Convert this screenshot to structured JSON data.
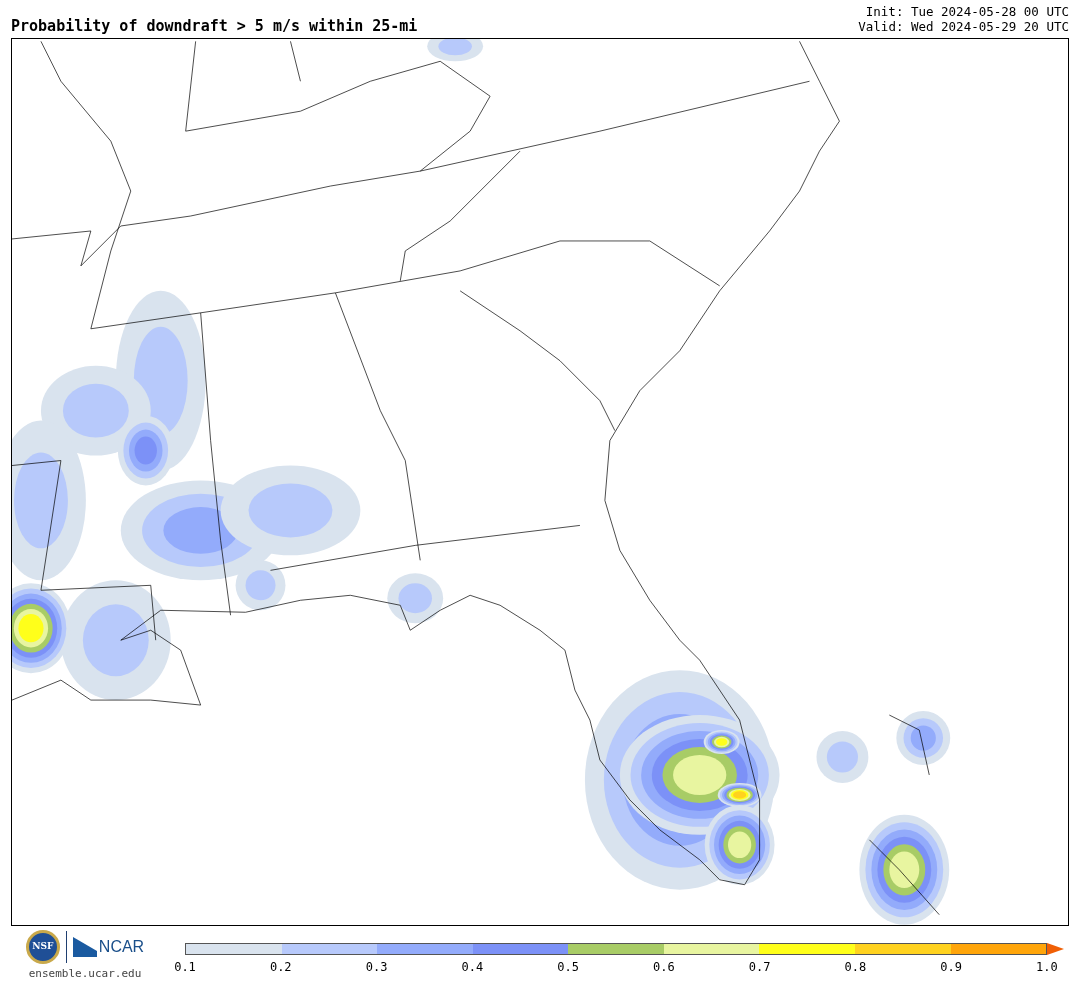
{
  "title": "Probability of downdraft > 5 m/s within 25-mi",
  "init": "Init: Tue 2024-05-28 00 UTC",
  "valid": "Valid: Wed 2024-05-29 20 UTC",
  "logos": {
    "nsf": "NSF",
    "ncar": "NCAR",
    "url": "ensemble.ucar.edu"
  },
  "colorbar": {
    "bins": [
      {
        "color": "#d9e3ee"
      },
      {
        "color": "#b7c9fb"
      },
      {
        "color": "#93abfb"
      },
      {
        "color": "#7c91f7"
      },
      {
        "color": "#a8cc66"
      },
      {
        "color": "#e8f5a0"
      },
      {
        "color": "#ffff1a"
      },
      {
        "color": "#ffd21f"
      },
      {
        "color": "#ffa50a"
      }
    ],
    "overflow_arrow": {
      "color": "#f05f05"
    },
    "ticks": [
      "0.1",
      "0.2",
      "0.3",
      "0.4",
      "0.5",
      "0.6",
      "0.7",
      "0.8",
      "0.9",
      "1.0"
    ]
  }
}
